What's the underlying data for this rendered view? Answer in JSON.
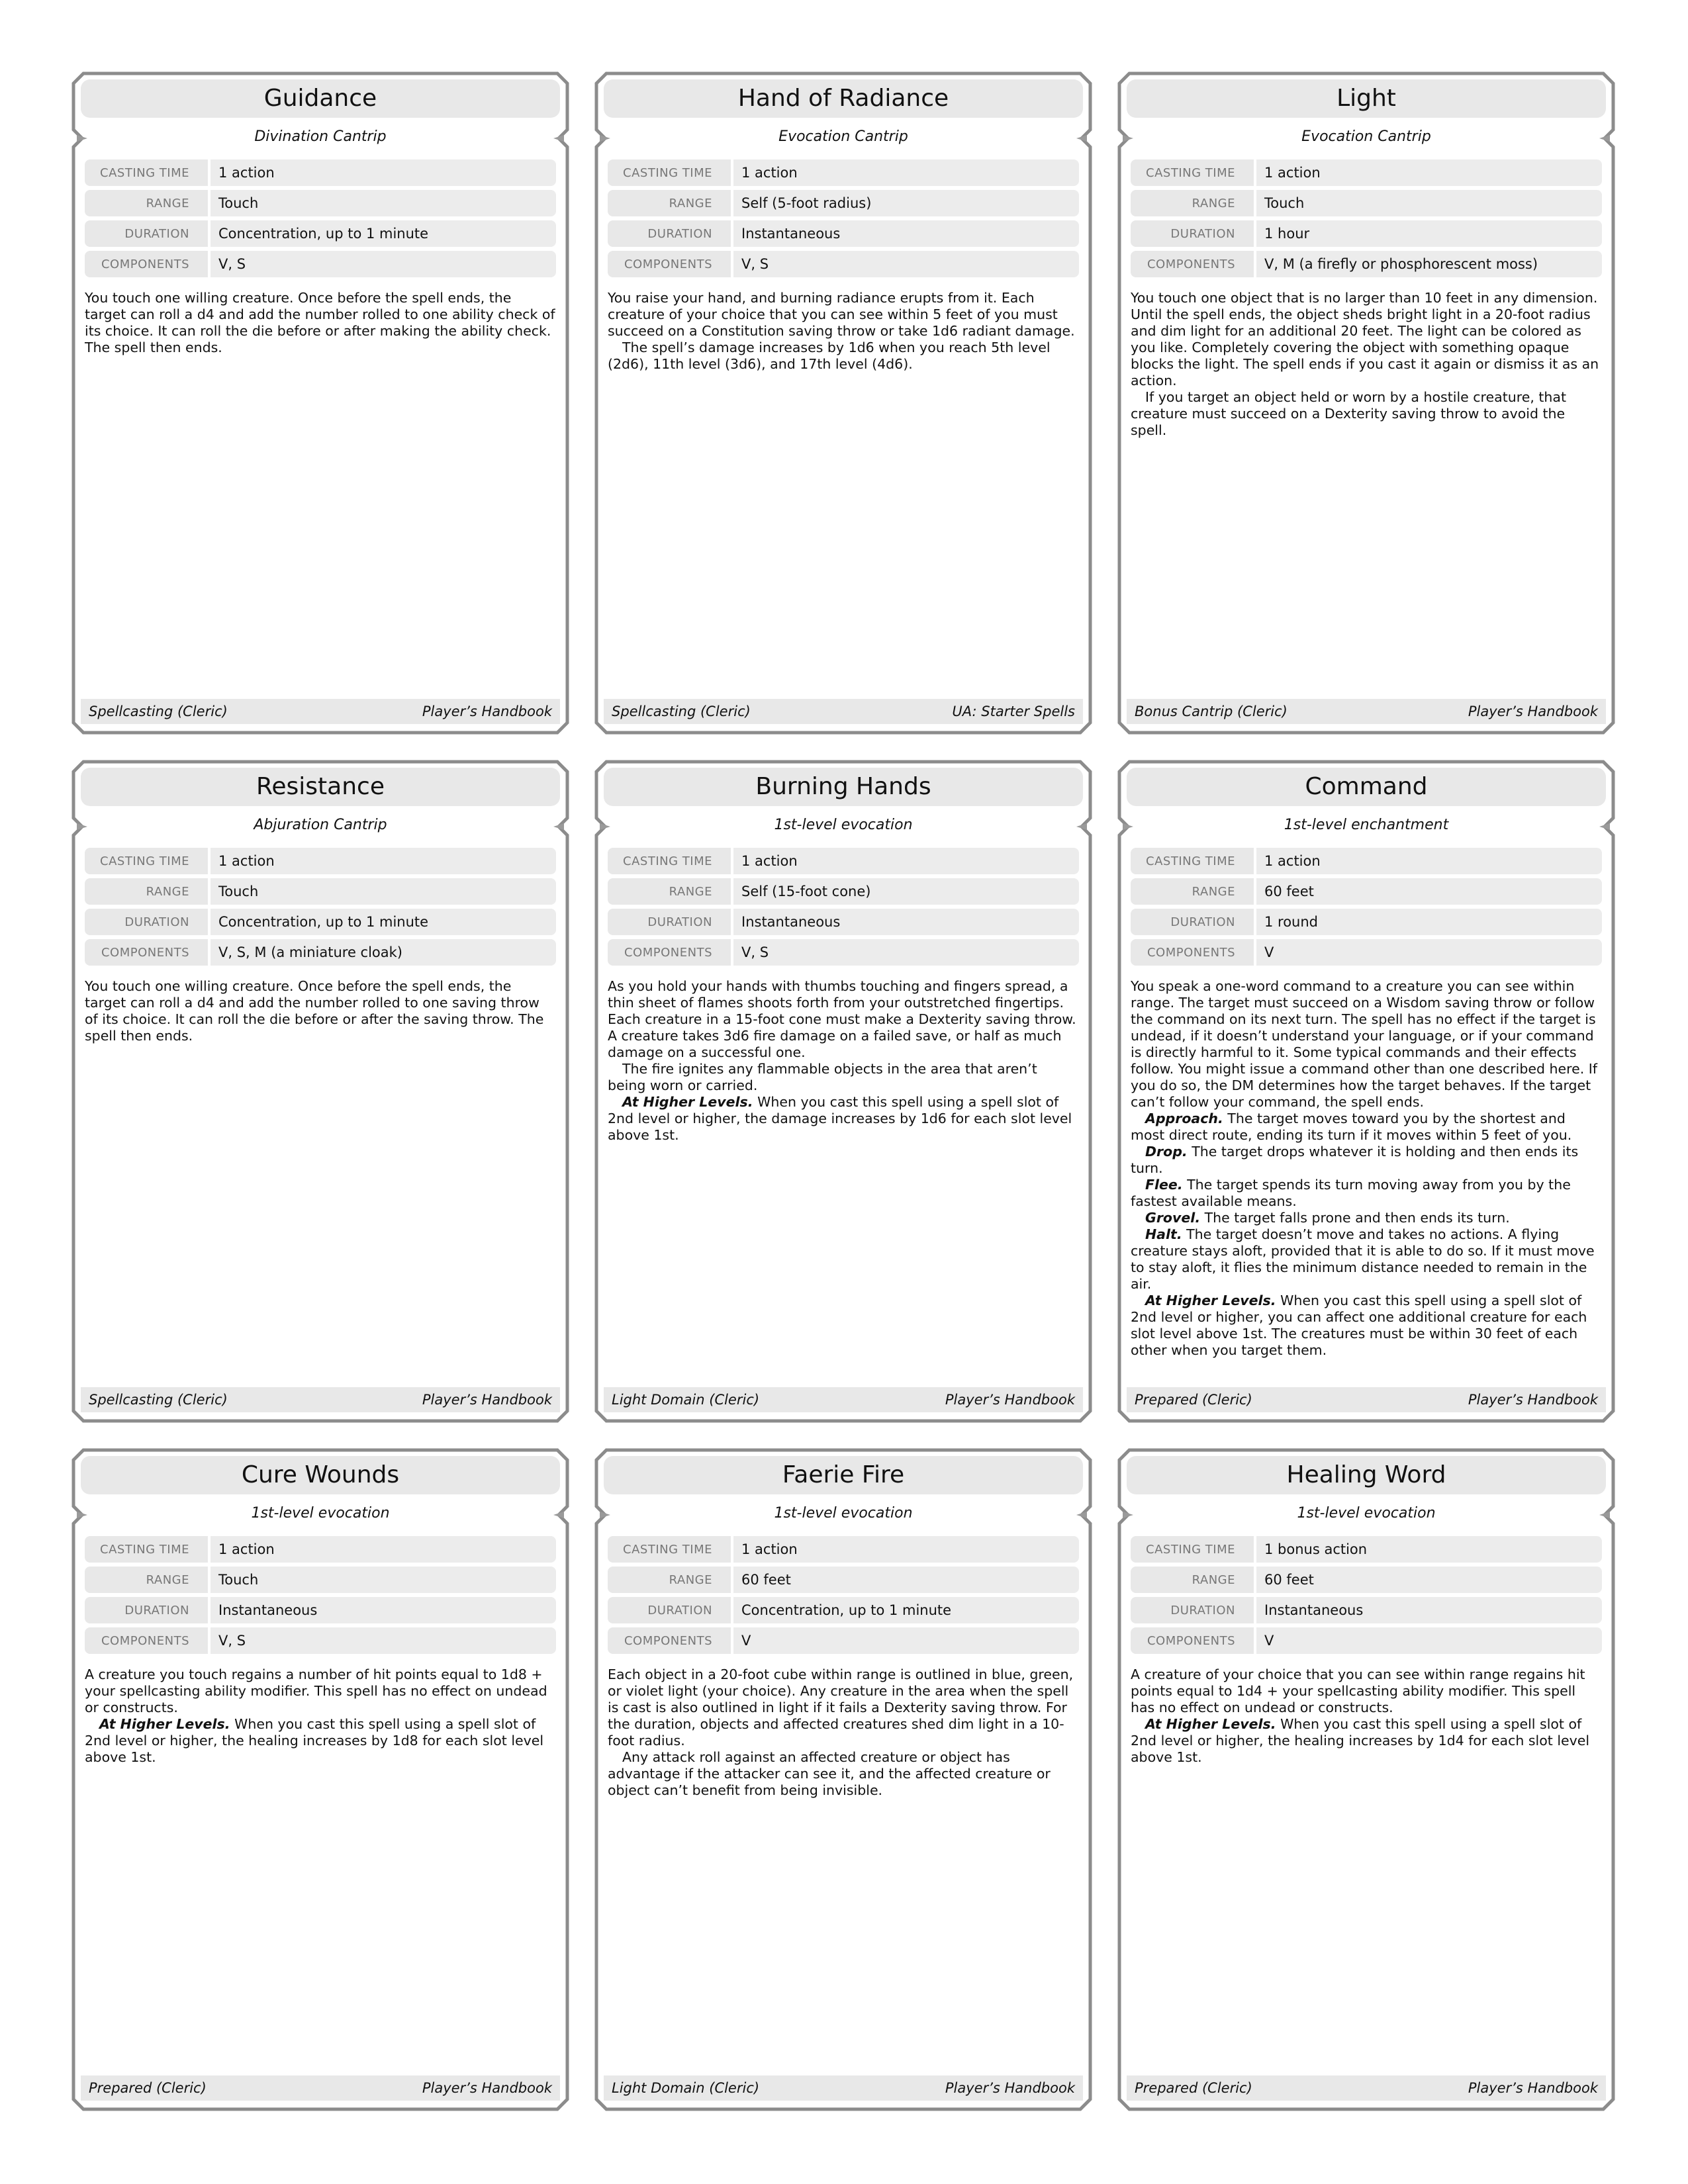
{
  "labels": {
    "casting_time": "CASTING TIME",
    "range": "RANGE",
    "duration": "DURATION",
    "components": "COMPONENTS"
  },
  "cards": [
    {
      "title": "Guidance",
      "school": "Divination Cantrip",
      "casting_time": "1 action",
      "range": "Touch",
      "duration": "Concentration, up to 1 minute",
      "components": "V, S",
      "paragraphs": [
        {
          "lead": "",
          "text": "You touch one willing creature. Once before the spell ends, the target can roll a d4 and add the number rolled to one ability check of its choice. It can roll the die before or after making the ability check. The spell then ends."
        }
      ],
      "footer_left": "Spellcasting (Cleric)",
      "footer_right": "Player’s Handbook"
    },
    {
      "title": "Hand of Radiance",
      "school": "Evocation Cantrip",
      "casting_time": "1 action",
      "range": "Self (5-foot radius)",
      "duration": "Instantaneous",
      "components": "V, S",
      "paragraphs": [
        {
          "lead": "",
          "text": "You raise your hand, and burning radiance erupts from it. Each creature of your choice that you can see within 5 feet of you must succeed on a Constitution saving throw or take 1d6 radiant damage."
        },
        {
          "lead": "",
          "text": "The spell’s damage increases by 1d6 when you reach 5th level (2d6), 11th level (3d6), and 17th level (4d6)."
        }
      ],
      "footer_left": "Spellcasting (Cleric)",
      "footer_right": "UA: Starter Spells"
    },
    {
      "title": "Light",
      "school": "Evocation Cantrip",
      "casting_time": "1 action",
      "range": "Touch",
      "duration": "1 hour",
      "components": "V, M (a firefly or phosphorescent moss)",
      "paragraphs": [
        {
          "lead": "",
          "text": "You touch one object that is no larger than 10 feet in any dimension. Until the spell ends, the object sheds bright light in a 20-foot radius and dim light for an additional 20 feet. The light can be colored as you like. Completely covering the object with something opaque blocks the light. The spell ends if you cast it again or dismiss it as an action."
        },
        {
          "lead": "",
          "text": "If you target an object held or worn by a hostile creature, that creature must succeed on a Dexterity saving throw to avoid the spell."
        }
      ],
      "footer_left": "Bonus Cantrip (Cleric)",
      "footer_right": "Player’s Handbook"
    },
    {
      "title": "Resistance",
      "school": "Abjuration Cantrip",
      "casting_time": "1 action",
      "range": "Touch",
      "duration": "Concentration, up to 1 minute",
      "components": "V, S, M (a miniature cloak)",
      "paragraphs": [
        {
          "lead": "",
          "text": "You touch one willing creature. Once before the spell ends, the target can roll a d4 and add the number rolled to one saving throw of its choice. It can roll the die before or after the saving throw. The spell then ends."
        }
      ],
      "footer_left": "Spellcasting (Cleric)",
      "footer_right": "Player’s Handbook"
    },
    {
      "title": "Burning Hands",
      "school": "1st-level evocation",
      "casting_time": "1 action",
      "range": "Self (15-foot cone)",
      "duration": "Instantaneous",
      "components": "V, S",
      "paragraphs": [
        {
          "lead": "",
          "text": "As you hold your hands with thumbs touching and fingers spread, a thin sheet of flames shoots forth from your outstretched fingertips. Each creature in a 15-foot cone must make a Dexterity saving throw. A creature takes 3d6 fire damage on a failed save, or half as much damage on a successful one."
        },
        {
          "lead": "",
          "text": "The fire ignites any flammable objects in the area that aren’t being worn or carried."
        },
        {
          "lead": "At Higher Levels.",
          "text": " When you cast this spell using a spell slot of 2nd level or higher, the damage increases by 1d6 for each slot level above 1st."
        }
      ],
      "footer_left": "Light Domain (Cleric)",
      "footer_right": "Player’s Handbook"
    },
    {
      "title": "Command",
      "school": "1st-level enchantment",
      "casting_time": "1 action",
      "range": "60 feet",
      "duration": "1 round",
      "components": "V",
      "paragraphs": [
        {
          "lead": "",
          "text": "You speak a one-word command to a creature you can see within range. The target must succeed on a Wisdom saving throw or follow the command on its next turn. The spell has no effect if the target is undead, if it doesn’t understand your language, or if your command is directly harmful to it. Some typical commands and their effects follow. You might issue a command other than one described here. If you do so, the DM determines how the target behaves. If the target can’t follow your command, the spell ends."
        },
        {
          "lead": "Approach.",
          "text": " The target moves toward you by the shortest and most direct route, ending its turn if it moves within 5 feet of you."
        },
        {
          "lead": "Drop.",
          "text": " The target drops whatever it is holding and then ends its turn."
        },
        {
          "lead": "Flee.",
          "text": " The target spends its turn moving away from you by the fastest available means."
        },
        {
          "lead": "Grovel.",
          "text": " The target falls prone and then ends its turn."
        },
        {
          "lead": "Halt.",
          "text": " The target doesn’t move and takes no actions. A flying creature stays aloft, provided that it is able to do so. If it must move to stay aloft, it flies the minimum distance needed to remain in the air."
        },
        {
          "lead": "At Higher Levels.",
          "text": " When you cast this spell using a spell slot of 2nd level or higher, you can affect one additional creature for each slot level above 1st. The creatures must be within 30 feet of each other when you target them."
        }
      ],
      "footer_left": "Prepared (Cleric)",
      "footer_right": "Player’s Handbook"
    },
    {
      "title": "Cure Wounds",
      "school": "1st-level evocation",
      "casting_time": "1 action",
      "range": "Touch",
      "duration": "Instantaneous",
      "components": "V, S",
      "paragraphs": [
        {
          "lead": "",
          "text": "A creature you touch regains a number of hit points equal to 1d8 + your spellcasting ability modifier. This spell has no effect on undead or constructs."
        },
        {
          "lead": "At Higher Levels.",
          "text": " When you cast this spell using a spell slot of 2nd level or higher, the healing increases by 1d8 for each slot level above 1st."
        }
      ],
      "footer_left": "Prepared (Cleric)",
      "footer_right": "Player’s Handbook"
    },
    {
      "title": "Faerie Fire",
      "school": "1st-level evocation",
      "casting_time": "1 action",
      "range": "60 feet",
      "duration": "Concentration, up to 1 minute",
      "components": "V",
      "paragraphs": [
        {
          "lead": "",
          "text": "Each object in a 20-foot cube within range is outlined in blue, green, or violet light (your choice). Any creature in the area when the spell is cast is also outlined in light if it fails a Dexterity saving throw. For the duration, objects and affected creatures shed dim light in a 10-foot radius."
        },
        {
          "lead": "",
          "text": "Any attack roll against an affected creature or object has advantage if the attacker can see it, and the affected creature or object can’t benefit from being invisible."
        }
      ],
      "footer_left": "Light Domain (Cleric)",
      "footer_right": "Player’s Handbook"
    },
    {
      "title": "Healing Word",
      "school": "1st-level evocation",
      "casting_time": "1 bonus action",
      "range": "60 feet",
      "duration": "Instantaneous",
      "components": "V",
      "paragraphs": [
        {
          "lead": "",
          "text": "A creature of your choice that you can see within range regains hit points equal to 1d4 + your spellcasting ability modifier. This spell has no effect on undead or constructs."
        },
        {
          "lead": "At Higher Levels.",
          "text": " When you cast this spell using a spell slot of 2nd level or higher, the healing increases by 1d4 for each slot level above 1st."
        }
      ],
      "footer_left": "Prepared (Cleric)",
      "footer_right": "Player’s Handbook"
    }
  ]
}
